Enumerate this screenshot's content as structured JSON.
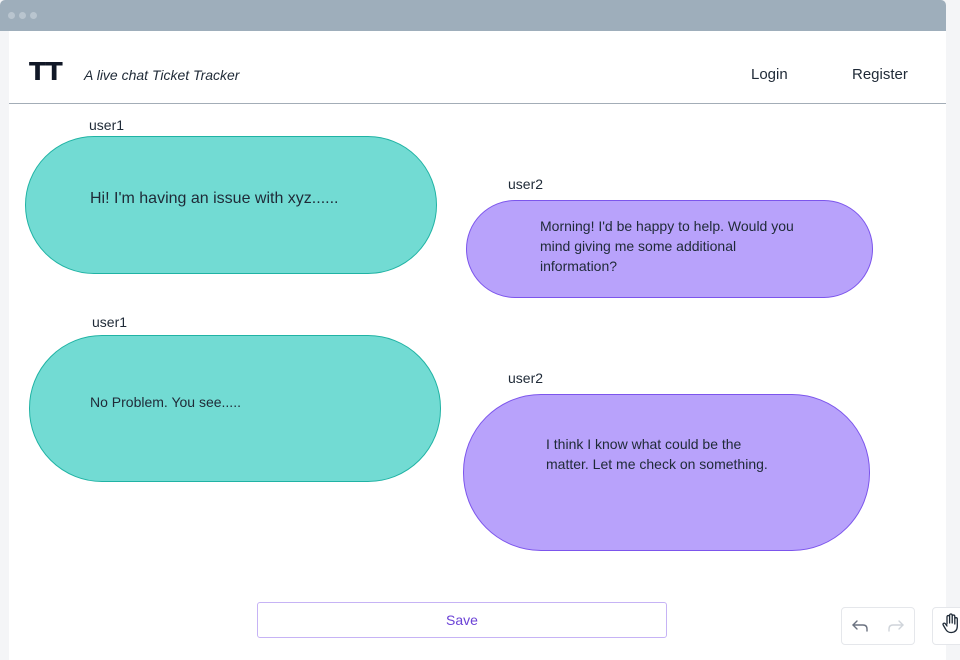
{
  "header": {
    "logo": "TT",
    "tagline": "A live chat Ticket Tracker",
    "login_label": "Login",
    "register_label": "Register"
  },
  "messages": [
    {
      "user": "user1",
      "text": "Hi! I'm having an issue with xyz......",
      "color": "#72dbd3"
    },
    {
      "user": "user2",
      "text": "Morning! I'd be happy to help. Would you mind giving me some additional information?",
      "color": "#b8a2fb"
    },
    {
      "user": "user1",
      "text": "No Problem. You see.....",
      "color": "#72dbd3"
    },
    {
      "user": "user2",
      "text": "I think I know what could be the matter. Let me check on something.",
      "color": "#b8a2fb"
    }
  ],
  "actions": {
    "save_label": "Save"
  },
  "controls": {
    "undo_icon": "undo-icon",
    "redo_icon": "redo-icon",
    "hand_icon": "hand-icon"
  },
  "colors": {
    "accent": "#6b42d6",
    "teal_bubble": "#72dbd3",
    "purple_bubble": "#b8a2fb"
  }
}
